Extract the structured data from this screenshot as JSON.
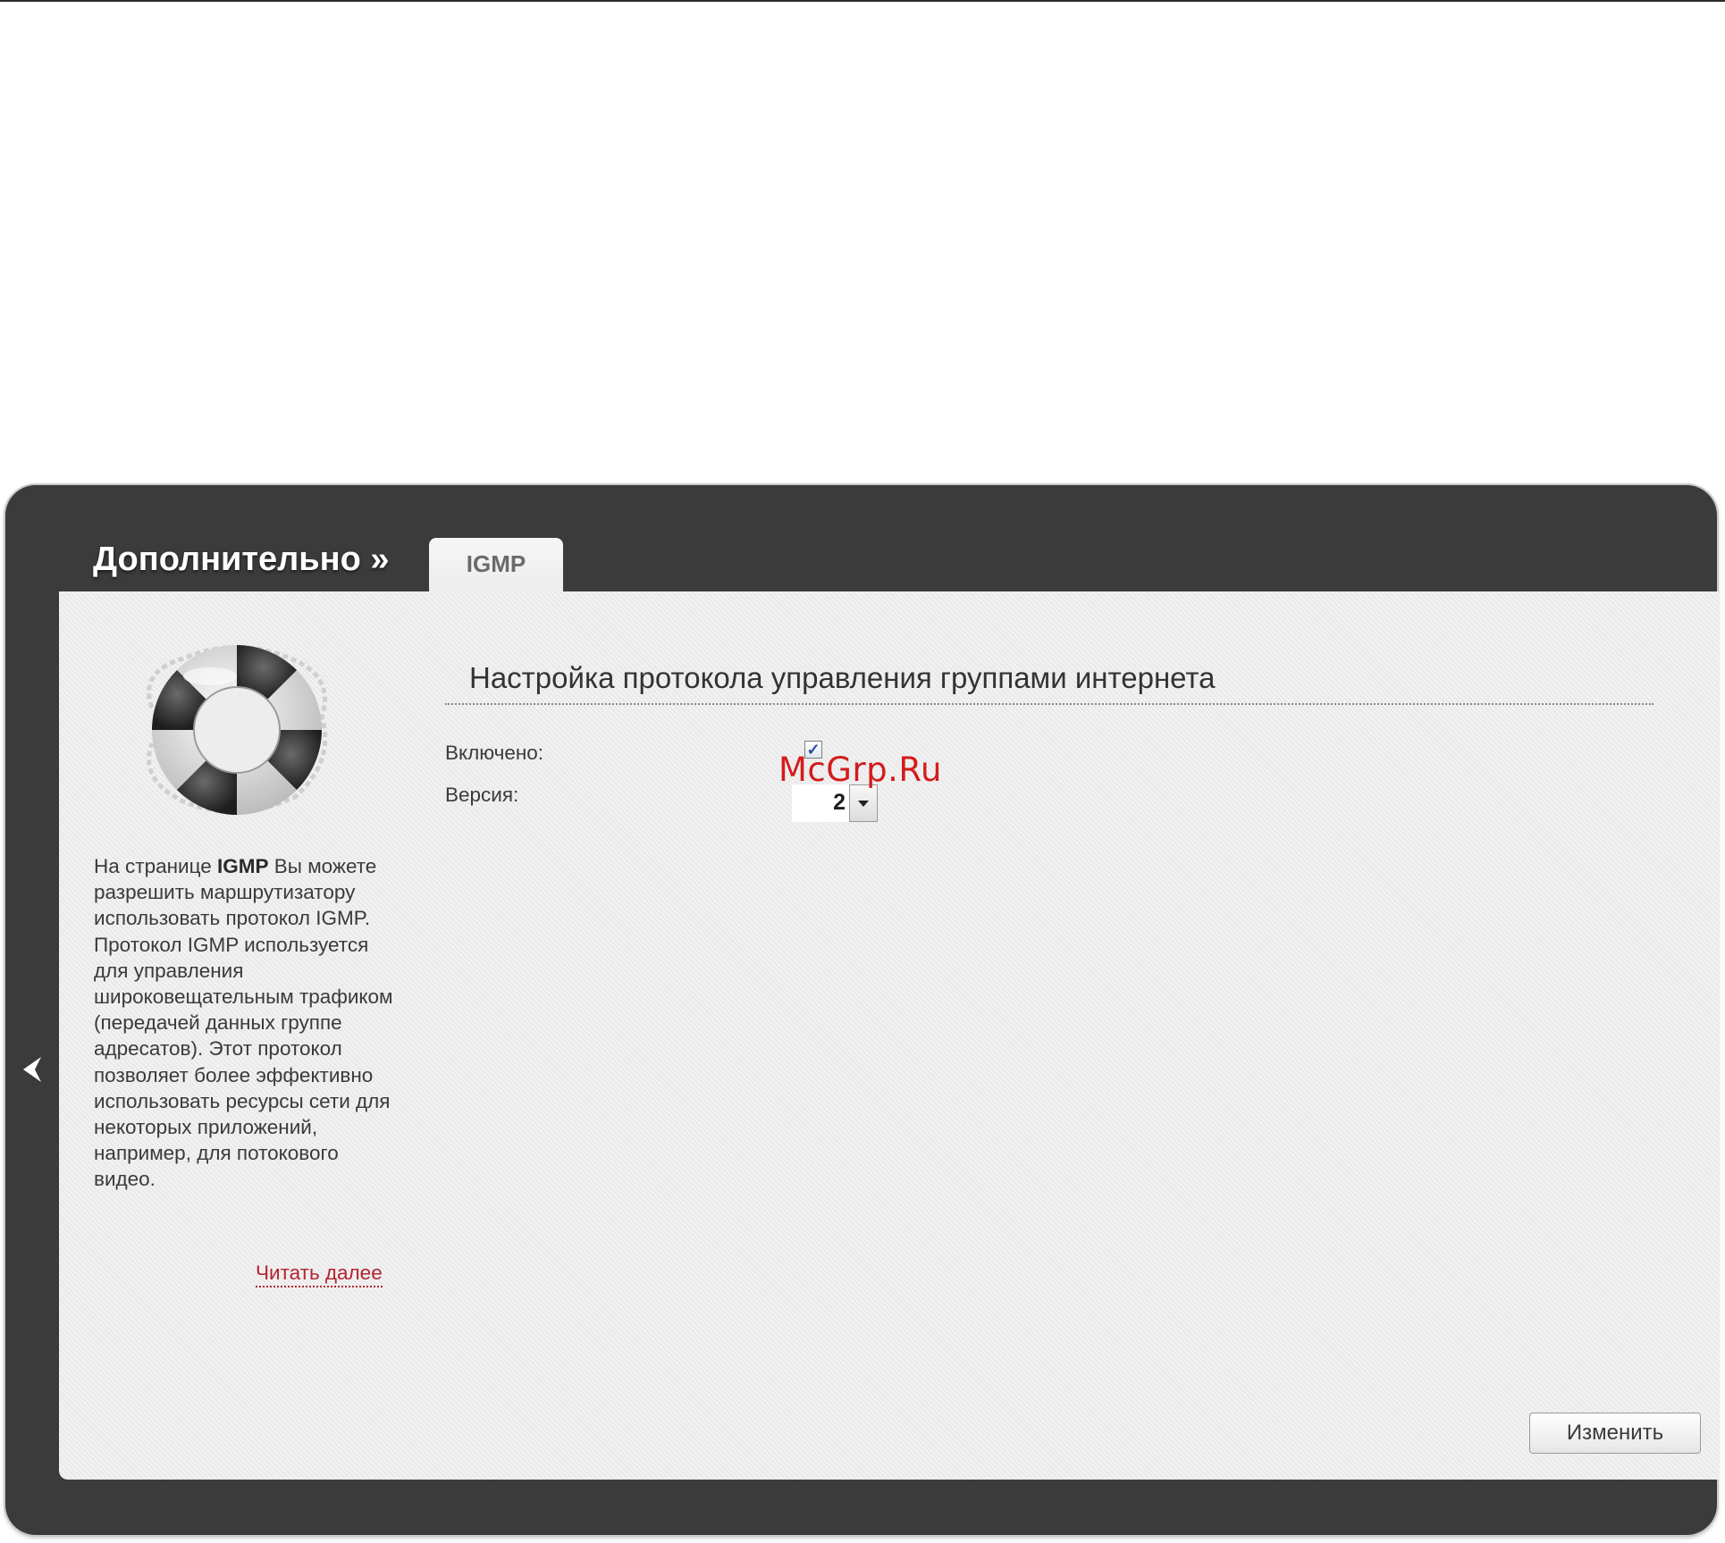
{
  "header": {
    "section_title": "Дополнительно »",
    "active_tab": "IGMP"
  },
  "sidebar": {
    "help_prefix": "На странице ",
    "help_bold": "IGMP",
    "help_suffix": " Вы можете разрешить маршрутизатору использовать протокол IGMP. Протокол IGMP используется для управления широковещательным трафиком (передачей данных группе адресатов). Этот протокол позволяет более эффективно использовать ресурсы сети для некоторых приложений, например, для потокового видео.",
    "read_more": "Читать далее",
    "icon": "lifebuoy-icon"
  },
  "form": {
    "heading": "Настройка протокола управления группами интернета",
    "enabled_label": "Включено:",
    "enabled_checked": true,
    "version_label": "Версия:",
    "version_value": "2"
  },
  "watermark": "McGrp.Ru",
  "actions": {
    "save_label": "Изменить"
  },
  "colors": {
    "frame": "#3b3b3b",
    "panel": "#ededed",
    "link": "#b3232e",
    "watermark": "#d31c1c"
  }
}
